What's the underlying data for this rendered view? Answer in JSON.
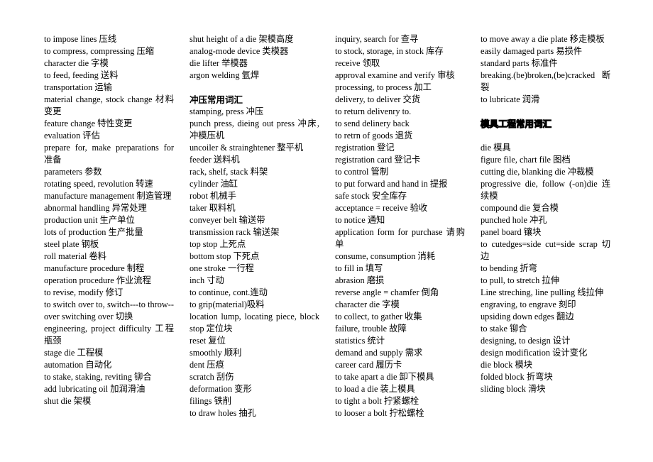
{
  "columns": [
    {
      "blocks": [
        {
          "type": "entries",
          "items": [
            "to impose lines 压线",
            "to compress, compressing 压缩",
            "character die 字模",
            "to feed, feeding 送料",
            "transportation 运输",
            "material change, stock change 材料变更",
            "feature change  特性变更",
            "evaluation 评估",
            "prepare for, make preparations for 准备",
            "parameters 参数",
            "rotating speed, revolution 转速",
            "manufacture management 制造管理",
            "abnormal handling 异常处理",
            "production unit 生产单位",
            "lots of production 生产批量",
            "steel plate 钢板",
            "roll material 卷料",
            "manufacture procedure 制程",
            "operation procedure 作业流程",
            "to revise, modify 修订",
            "to switch over to, switch---to throw--over switching over 切换",
            "engineering, project difficulty 工程瓶颈",
            "stage die 工程模",
            "automation 自动化",
            "to stake, staking, reviting 铆合",
            "add lubricating oil 加润滑油",
            "shut die 架模"
          ]
        }
      ]
    },
    {
      "blocks": [
        {
          "type": "entries",
          "items": [
            "shut height of a die 架模高度",
            "analog-mode device 类模器",
            "die lifter 举模器",
            "argon welding 氩焊"
          ]
        },
        {
          "type": "heading",
          "text": "冲压常用词汇",
          "style": "bold"
        },
        {
          "type": "entries",
          "items": [
            "stamping, press 冲压",
            "punch press, dieing out press 冲床, 冲模压机",
            "uncoiler & strainghtener 整平机",
            "feeder 送料机",
            "rack, shelf, stack 料架",
            "cylinder 油缸",
            "robot 机械手",
            "taker 取料机",
            "conveyer belt 输送带",
            "transmission rack 输送架",
            "top stop 上死点",
            "bottom stop 下死点",
            "one stroke 一行程",
            "inch 寸动",
            "to continue, cont.连动",
            "to grip(material)吸料",
            "location lump, locating piece, block stop  定位块",
            "reset 复位",
            "smoothly 顺利",
            "dent 压痕",
            "scratch 刮伤",
            "deformation 变形",
            "filings 铁削",
            "to draw holes 抽孔"
          ]
        }
      ]
    },
    {
      "blocks": [
        {
          "type": "entries",
          "items": [
            "inquiry, search for 查寻",
            "to stock, storage, in stock 库存",
            "receive 领取",
            "approval examine and verify 审核",
            "processing, to process 加工",
            "delivery, to deliver  交货",
            "to return delivenry to.",
            "to send delinery back",
            "to retrn of goods 退货",
            "registration 登记",
            "registration card 登记卡",
            "to control 管制",
            "to put forward and hand in 提报",
            "safe stock 安全库存",
            "acceptance = receive 验收",
            "to notice 通知",
            "application form for purchase 请购单",
            "consume, consumption 消耗",
            "to fill in 填写",
            "abrasion 磨损",
            "reverse angle = chamfer 倒角",
            "character die 字模",
            "to collect, to gather 收集",
            "failure, trouble 故障",
            "statistics 统计",
            "demand and supply 需求",
            "career card 履历卡",
            "to take apart a die 卸下模具",
            "to load a die 装上模具",
            "to tight a bolt 拧紧螺栓",
            "to looser a bolt 拧松螺栓"
          ]
        }
      ]
    },
    {
      "blocks": [
        {
          "type": "entries",
          "items": [
            "to move away a die plate 移走模板",
            "easily damaged parts 易损件",
            "standard parts 标准件",
            "breaking.(be)broken,(be)cracked 断裂",
            "to lubricate 润滑"
          ]
        },
        {
          "type": "heading",
          "text": "模具工程常用词汇",
          "style": "outline"
        },
        {
          "type": "entries",
          "items": [
            "die  模具",
            "figure file, chart file 图档",
            "cutting die, blanking die 冲裁模",
            "progressive die, follow (-on)die 连续模",
            "compound die 复合模",
            "punched hole 冲孔",
            "panel board 镶块",
            "to cutedges=side cut=side scrap 切边",
            "to bending 折弯",
            "to pull, to stretch 拉伸",
            "Line streching, line pulling 线拉伸",
            "engraving, to engrave 刻印",
            "upsiding down edges 翻边",
            "to stake 铆合",
            "designing, to design 设计",
            "design modification 设计变化",
            "die block 模块",
            "folded block 折弯块",
            "sliding block 滑块"
          ]
        }
      ]
    }
  ]
}
